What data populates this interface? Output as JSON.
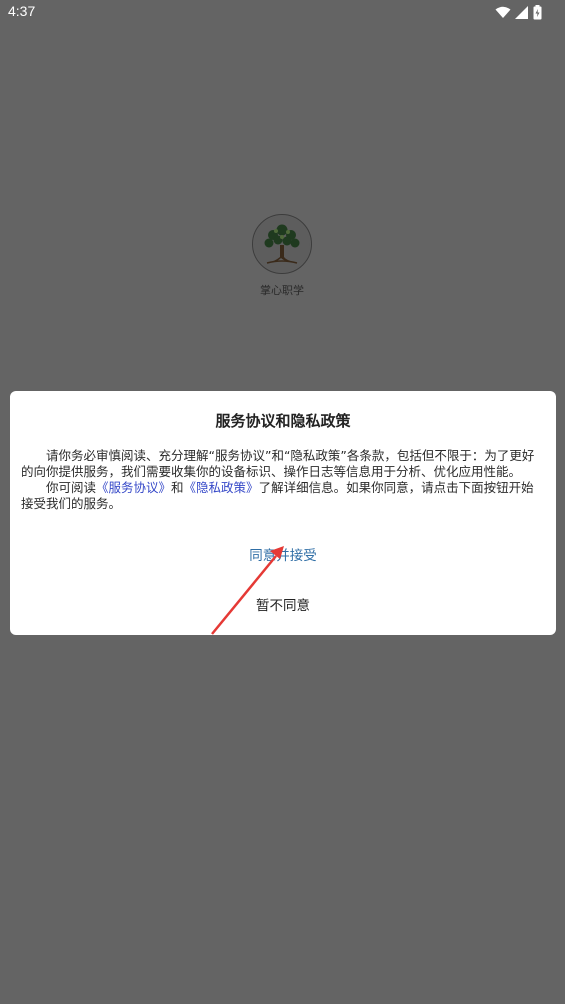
{
  "status_bar": {
    "time": "4:37",
    "icons": [
      "wifi-icon",
      "signal-icon",
      "battery-icon"
    ]
  },
  "app": {
    "name": "掌心职学",
    "logo_icon": "tree-logo-icon"
  },
  "dialog": {
    "title": "服务协议和隐私政策",
    "para1": "请你务必审慎阅读、充分理解“服务协议”和“隐私政策”各条款，包括但不限于：为了更好的向你提供服务，我们需要收集你的设备标识、操作日志等信息用于分析、优化应用性能。",
    "para2_prefix": "你可阅读",
    "link_service": "《服务协议》",
    "para2_and": "和",
    "link_privacy": "《隐私政策》",
    "para2_suffix": "了解详细信息。如果你同意，请点击下面按钮开始接受我们的服务。",
    "agree_label": "同意并接受",
    "disagree_label": "暂不同意"
  },
  "colors": {
    "backdrop": "#646464",
    "link": "#3548c8",
    "agree": "#2f6ea6",
    "arrow": "#e53935"
  }
}
